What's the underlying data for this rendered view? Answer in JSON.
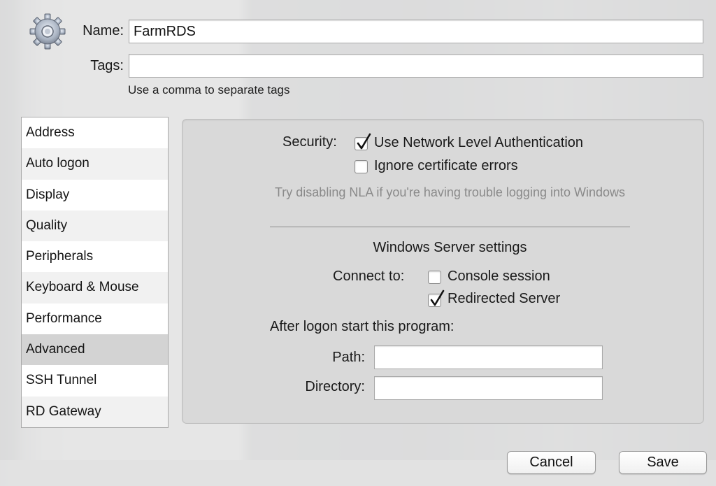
{
  "header": {
    "name_label": "Name:",
    "name_value": "FarmRDS",
    "tags_label": "Tags:",
    "tags_value": "",
    "tags_hint": "Use a comma to separate tags"
  },
  "sidebar": {
    "items": [
      {
        "label": "Address"
      },
      {
        "label": "Auto logon"
      },
      {
        "label": "Display"
      },
      {
        "label": "Quality"
      },
      {
        "label": "Peripherals"
      },
      {
        "label": "Keyboard & Mouse"
      },
      {
        "label": "Performance"
      },
      {
        "label": "Advanced",
        "selected": true
      },
      {
        "label": "SSH Tunnel"
      },
      {
        "label": "RD Gateway"
      }
    ]
  },
  "advanced": {
    "security_label": "Security:",
    "nla": {
      "label": "Use Network Level Authentication",
      "checked": true
    },
    "ignore_cert": {
      "label": "Ignore certificate errors",
      "checked": false
    },
    "nla_hint": "Try disabling NLA if you're having trouble logging into Windows",
    "server_heading": "Windows Server settings",
    "connect_to_label": "Connect to:",
    "console_session": {
      "label": "Console session",
      "checked": false
    },
    "redirected_server": {
      "label": "Redirected Server",
      "checked": true
    },
    "after_logon_label": "After logon start this program:",
    "path_label": "Path:",
    "path_value": "",
    "directory_label": "Directory:",
    "directory_value": ""
  },
  "footer": {
    "cancel_label": "Cancel",
    "save_label": "Save"
  },
  "icons": {
    "header": "gear-icon",
    "check": "checkmark-icon"
  }
}
